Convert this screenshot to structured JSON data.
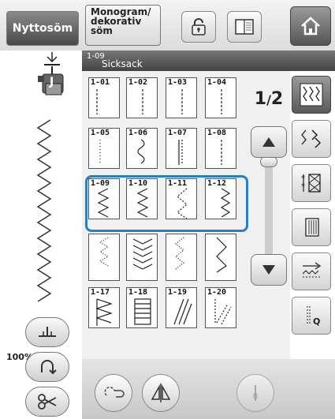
{
  "tabs": {
    "utility": "Nyttosöm",
    "decorative": "Monogram/\ndekorativ\nsöm"
  },
  "needle_position": "100%",
  "stitch_header": {
    "code": "1-09",
    "name": "Sicksack"
  },
  "pager": {
    "current": "1",
    "total": "2"
  },
  "stitches": [
    {
      "code": "1-01",
      "pattern": "straight-left"
    },
    {
      "code": "1-02",
      "pattern": "straight-center"
    },
    {
      "code": "1-03",
      "pattern": "straight-center"
    },
    {
      "code": "1-04",
      "pattern": "straight-center"
    },
    {
      "code": "1-05",
      "pattern": "straight-dot"
    },
    {
      "code": "1-06",
      "pattern": "s-curve"
    },
    {
      "code": "1-07",
      "pattern": "triple-straight"
    },
    {
      "code": "1-08",
      "pattern": "straight-center"
    },
    {
      "code": "1-09",
      "pattern": "zigzag-left"
    },
    {
      "code": "1-10",
      "pattern": "zigzag-center"
    },
    {
      "code": "1-11",
      "pattern": "zigzag-dotted"
    },
    {
      "code": "1-12",
      "pattern": "zigzag-right"
    },
    {
      "code": "",
      "pattern": "chevron-dotted"
    },
    {
      "code": "",
      "pattern": "double-zigzag"
    },
    {
      "code": "",
      "pattern": "dotted-zigzag"
    },
    {
      "code": "",
      "pattern": "wave"
    },
    {
      "code": "1-17",
      "pattern": "overlock-zigzag"
    },
    {
      "code": "1-18",
      "pattern": "overlock-ladder"
    },
    {
      "code": "1-19",
      "pattern": "diagonal"
    },
    {
      "code": "1-20",
      "pattern": "dotted-diagonal"
    }
  ],
  "selected_index": 8,
  "icons": {
    "lock": "lock-icon",
    "book": "manual-icon",
    "home": "home-icon",
    "presser_foot": "presser-foot-J-icon",
    "needle": "needle-icon"
  },
  "colors": {
    "selection": "#2a7fc0",
    "header_bg": "#555555",
    "active_tab": "#5a5a5a"
  }
}
